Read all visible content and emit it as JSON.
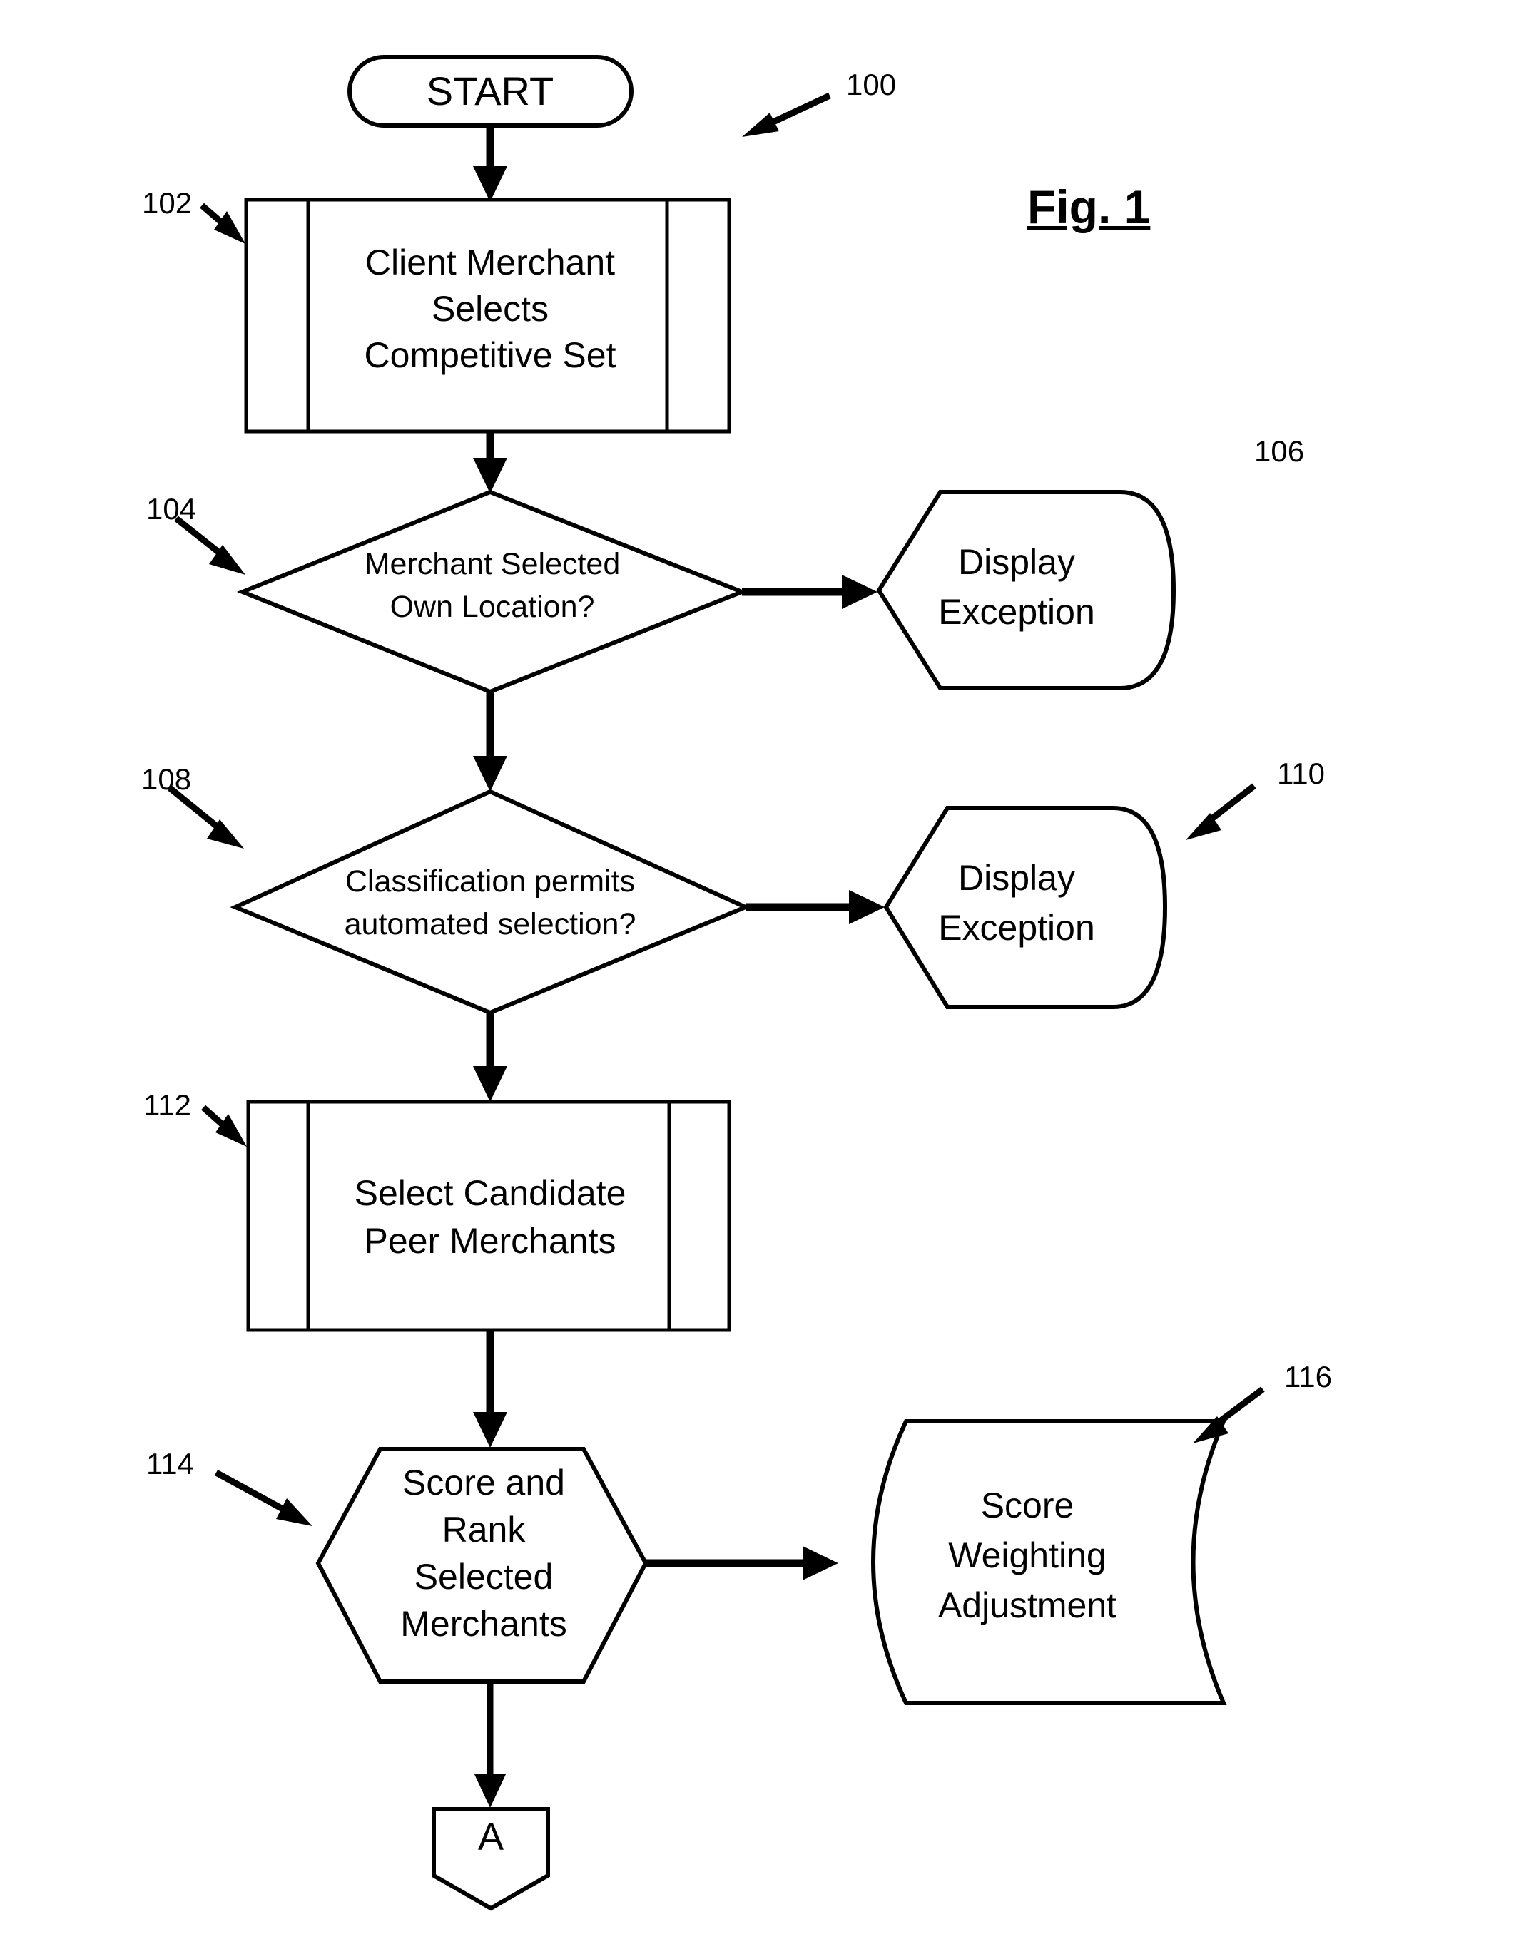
{
  "figure": {
    "title": "Fig. 1",
    "overall_ref": "100"
  },
  "nodes": {
    "start": {
      "ref": "",
      "label": "START",
      "shape": "terminator"
    },
    "client_merchant": {
      "ref": "102",
      "line1": "Client Merchant",
      "line2": "Selects",
      "line3": "Competitive Set",
      "shape": "predefined-process"
    },
    "own_location_decision": {
      "ref": "104",
      "line1": "Merchant Selected",
      "line2": "Own Location?",
      "shape": "decision"
    },
    "display_exception_1": {
      "ref": "106",
      "line1": "Display",
      "line2": "Exception",
      "shape": "display"
    },
    "classification_decision": {
      "ref": "108",
      "line1": "Classification permits",
      "line2": "automated selection?",
      "shape": "decision"
    },
    "display_exception_2": {
      "ref": "110",
      "line1": "Display",
      "line2": "Exception",
      "shape": "display"
    },
    "select_candidates": {
      "ref": "112",
      "line1": "Select Candidate",
      "line2": "Peer Merchants",
      "shape": "predefined-process"
    },
    "score_and_rank": {
      "ref": "114",
      "line1": "Score and",
      "line2": "Rank",
      "line3": "Selected",
      "line4": "Merchants",
      "shape": "preparation-hexagon"
    },
    "score_weighting": {
      "ref": "116",
      "line1": "Score",
      "line2": "Weighting",
      "line3": "Adjustment",
      "shape": "stored-data"
    },
    "offpage_connector": {
      "ref": "",
      "label": "A",
      "shape": "offpage-connector"
    }
  },
  "colors": {
    "stroke": "#000000",
    "background": "#ffffff"
  }
}
